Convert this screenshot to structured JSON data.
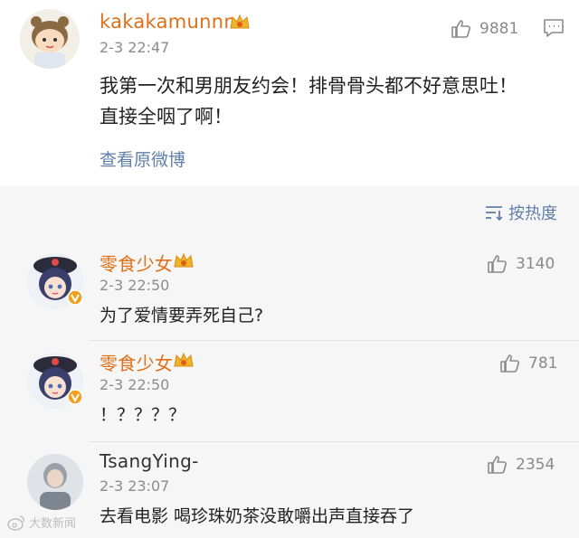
{
  "main_post": {
    "username": "kakakamunnn",
    "time": "2-3 22:47",
    "likes": "9881",
    "text_line1": "我第一次和男朋友约会！排骨骨头都不好意思吐！",
    "text_line2": "直接全咽了啊！",
    "view_original": "查看原微博"
  },
  "sort": {
    "label": "按热度"
  },
  "comments": [
    {
      "username": "零食少女",
      "time": "2-3 22:50",
      "likes": "3140",
      "text": "为了爱情要弄死自己?"
    },
    {
      "username": "零食少女",
      "time": "2-3 22:50",
      "likes": "781",
      "text": "！？？？？"
    },
    {
      "username": "TsangYing-",
      "time": "2-3 23:07",
      "likes": "2354",
      "text": "去看电影 喝珍珠奶茶没敢嚼出声直接吞了"
    }
  ],
  "watermark": {
    "text": "大数新闻"
  },
  "colors": {
    "orange_name": "#e06f17",
    "link_blue": "#5f7fa8",
    "muted": "#8c8c8c"
  }
}
